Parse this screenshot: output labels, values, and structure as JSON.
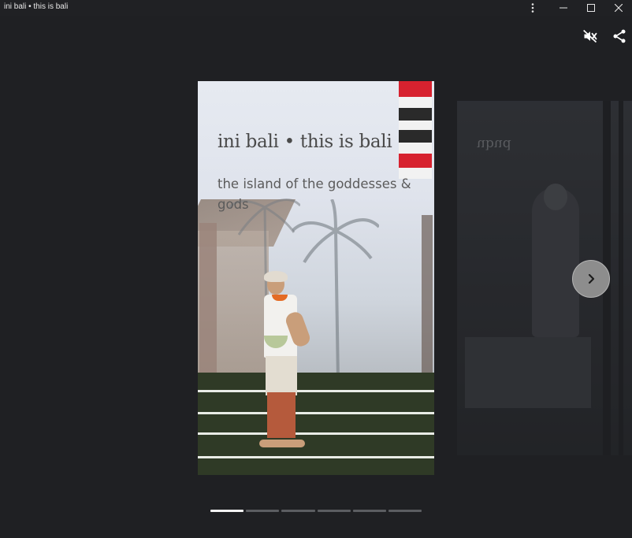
{
  "window": {
    "title": "ini bali • this is bali"
  },
  "titlebar_icons": {
    "more": "more-vert-icon",
    "minimize": "minimize-icon",
    "maximize": "maximize-icon",
    "close": "close-icon"
  },
  "actions": {
    "mute_icon": "volume-off-icon",
    "share_icon": "share-icon"
  },
  "story": {
    "title": "ini bali • this is bali",
    "subtitle": "the island of the goddesses & gods"
  },
  "next_story": {
    "caption": "ubud"
  },
  "navigation": {
    "next_icon": "chevron-right-icon"
  },
  "progress": {
    "segments": 6,
    "active_index": 0
  },
  "colors": {
    "background": "#1f2023",
    "progress_active": "#f4f4f4",
    "progress_inactive": "#5b5d61",
    "flag_red": "#d7222f"
  }
}
